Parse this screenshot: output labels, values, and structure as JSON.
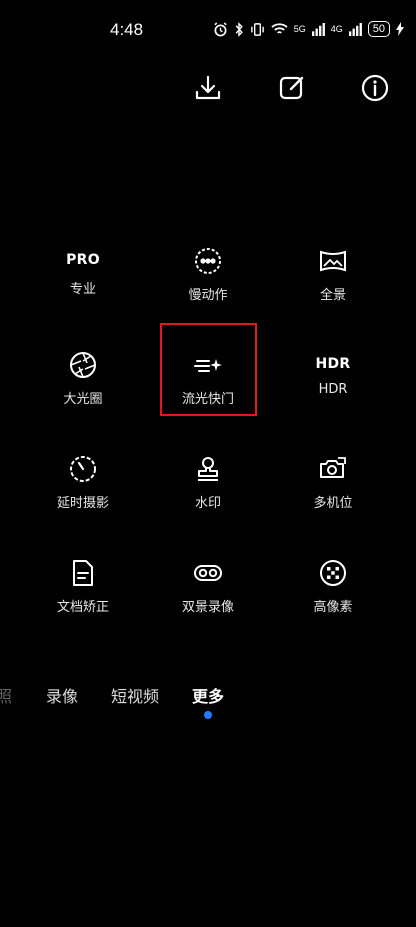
{
  "status_bar": {
    "time": "4:48",
    "net1": "5G",
    "net2": "4G",
    "battery": "50"
  },
  "grid": [
    {
      "big": "PRO",
      "label": "专业"
    },
    {
      "icon": "slow-motion-icon",
      "label": "慢动作"
    },
    {
      "icon": "panorama-icon",
      "label": "全景"
    },
    {
      "icon": "aperture-icon",
      "label": "大光圈"
    },
    {
      "icon": "light-trail-icon",
      "label": "流光快门"
    },
    {
      "big": "HDR",
      "label": "HDR"
    },
    {
      "icon": "timelapse-icon",
      "label": "延时摄影"
    },
    {
      "icon": "watermark-stamp-icon",
      "label": "水印"
    },
    {
      "icon": "multi-camera-icon",
      "label": "多机位"
    },
    {
      "icon": "document-icon",
      "label": "文档矫正"
    },
    {
      "icon": "dual-view-icon",
      "label": "双景录像"
    },
    {
      "icon": "high-pixel-icon",
      "label": "高像素"
    }
  ],
  "modes": {
    "partial": "照",
    "video": "录像",
    "short_video": "短视频",
    "more": "更多"
  },
  "accent": "#2979ff"
}
